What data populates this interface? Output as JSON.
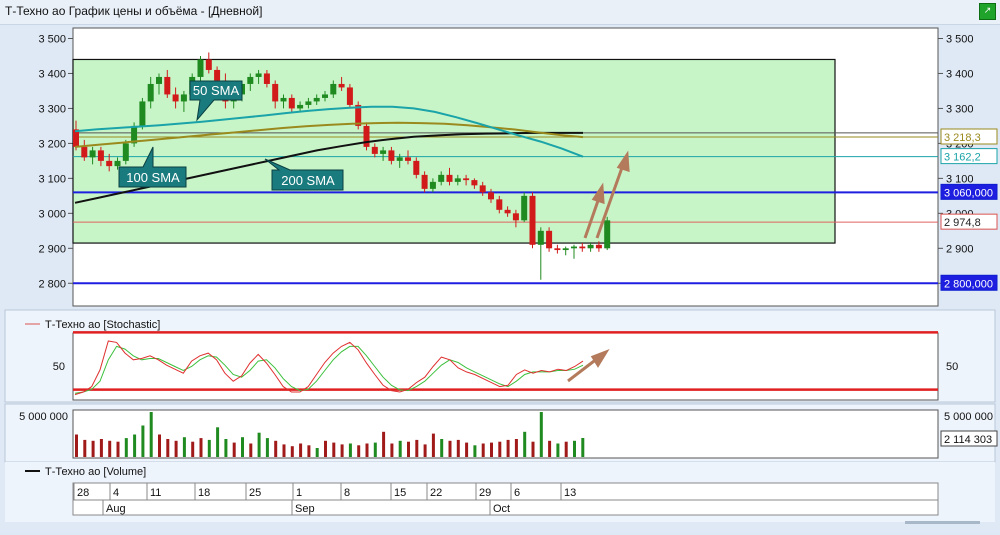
{
  "window": {
    "title": "Т-Техно ао График цены и объёма - [Дневной]"
  },
  "price_panel": {
    "y_ticks": [
      "3 500",
      "3 400",
      "3 300",
      "3 200",
      "3 100",
      "3 000",
      "2 900",
      "2 800"
    ],
    "price_labels": [
      {
        "text": "3 218,3",
        "value": 3218.3,
        "color": "#9a8a1e",
        "fill": "#ffffff",
        "text_color": "#9a8a1e"
      },
      {
        "text": "3 162,2",
        "value": 3162.2,
        "color": "#1aa3a8",
        "fill": "#ffffff",
        "text_color": "#1aa3a8"
      },
      {
        "text": "3 060,000",
        "value": 3060,
        "color": "#0f1fd0",
        "fill": "#1e1ee0",
        "text_color": "#ffffff"
      },
      {
        "text": "2 974,8",
        "value": 2974.8,
        "color": "#d9534f",
        "fill": "#ffffff",
        "text_color": "#222222"
      },
      {
        "text": "2 800,000",
        "value": 2800,
        "color": "#0f1fd0",
        "fill": "#1e1ee0",
        "text_color": "#ffffff"
      }
    ],
    "annotations": {
      "sma50": "50 SMA",
      "sma100": "100 SMA",
      "sma200": "200 SMA"
    }
  },
  "stochastic_panel": {
    "legend": "Т-Техно ао [Stochastic]",
    "tick": "50",
    "levels": [
      80,
      20
    ]
  },
  "volume_panel": {
    "legend": "Т-Техно ао [Volume]",
    "top_label": "5 000 000",
    "last_label": "2 114 303"
  },
  "time_axis": {
    "days": [
      "28",
      "4",
      "11",
      "18",
      "25",
      "1",
      "8",
      "15",
      "22",
      "29",
      "6",
      "13"
    ],
    "months": [
      "Aug",
      "Sep",
      "Oct"
    ]
  },
  "chart_data": {
    "type": "candlestick",
    "y_range": [
      2735,
      3530
    ],
    "candles": [
      [
        3240,
        3265,
        3180,
        3190
      ],
      [
        3190,
        3210,
        3150,
        3160
      ],
      [
        3160,
        3190,
        3140,
        3180
      ],
      [
        3180,
        3190,
        3135,
        3150
      ],
      [
        3150,
        3170,
        3120,
        3135
      ],
      [
        3135,
        3160,
        3125,
        3150
      ],
      [
        3150,
        3210,
        3140,
        3200
      ],
      [
        3200,
        3260,
        3190,
        3250
      ],
      [
        3250,
        3330,
        3240,
        3320
      ],
      [
        3320,
        3390,
        3300,
        3370
      ],
      [
        3370,
        3400,
        3340,
        3390
      ],
      [
        3390,
        3410,
        3330,
        3340
      ],
      [
        3340,
        3360,
        3300,
        3320
      ],
      [
        3320,
        3350,
        3290,
        3340
      ],
      [
        3340,
        3400,
        3330,
        3390
      ],
      [
        3390,
        3450,
        3380,
        3440
      ],
      [
        3440,
        3460,
        3400,
        3410
      ],
      [
        3410,
        3420,
        3370,
        3380
      ],
      [
        3380,
        3400,
        3300,
        3320
      ],
      [
        3320,
        3350,
        3300,
        3340
      ],
      [
        3340,
        3380,
        3320,
        3370
      ],
      [
        3370,
        3400,
        3350,
        3390
      ],
      [
        3390,
        3410,
        3370,
        3400
      ],
      [
        3400,
        3410,
        3360,
        3370
      ],
      [
        3370,
        3380,
        3300,
        3320
      ],
      [
        3320,
        3340,
        3300,
        3330
      ],
      [
        3330,
        3340,
        3290,
        3300
      ],
      [
        3300,
        3320,
        3290,
        3310
      ],
      [
        3310,
        3330,
        3300,
        3320
      ],
      [
        3320,
        3340,
        3310,
        3330
      ],
      [
        3330,
        3350,
        3320,
        3340
      ],
      [
        3340,
        3380,
        3330,
        3370
      ],
      [
        3370,
        3390,
        3350,
        3360
      ],
      [
        3360,
        3370,
        3300,
        3310
      ],
      [
        3310,
        3320,
        3240,
        3250
      ],
      [
        3250,
        3260,
        3180,
        3190
      ],
      [
        3190,
        3200,
        3160,
        3170
      ],
      [
        3170,
        3190,
        3150,
        3180
      ],
      [
        3180,
        3190,
        3140,
        3150
      ],
      [
        3150,
        3170,
        3130,
        3160
      ],
      [
        3160,
        3180,
        3140,
        3150
      ],
      [
        3150,
        3160,
        3100,
        3110
      ],
      [
        3110,
        3120,
        3060,
        3070
      ],
      [
        3070,
        3100,
        3060,
        3090
      ],
      [
        3090,
        3120,
        3080,
        3110
      ],
      [
        3110,
        3130,
        3080,
        3090
      ],
      [
        3090,
        3110,
        3080,
        3100
      ],
      [
        3100,
        3110,
        3080,
        3095
      ],
      [
        3095,
        3100,
        3070,
        3080
      ],
      [
        3080,
        3090,
        3050,
        3060
      ],
      [
        3060,
        3070,
        3030,
        3040
      ],
      [
        3040,
        3050,
        3000,
        3010
      ],
      [
        3010,
        3020,
        2990,
        3000
      ],
      [
        3000,
        3010,
        2960,
        2980
      ],
      [
        2980,
        3060,
        2975,
        3050
      ],
      [
        3050,
        3060,
        2900,
        2910
      ],
      [
        2910,
        2960,
        2810,
        2950
      ],
      [
        2950,
        2960,
        2890,
        2900
      ],
      [
        2900,
        2910,
        2885,
        2895
      ],
      [
        2895,
        2905,
        2880,
        2900
      ],
      [
        2900,
        2910,
        2870,
        2905
      ],
      [
        2905,
        2915,
        2890,
        2900
      ],
      [
        2900,
        2915,
        2890,
        2910
      ],
      [
        2910,
        2920,
        2890,
        2900
      ],
      [
        2900,
        2990,
        2895,
        2980
      ]
    ],
    "sma50": [
      3235,
      3240,
      3244,
      3248,
      3252,
      3257,
      3262,
      3268,
      3274,
      3280,
      3287,
      3293,
      3298,
      3302,
      3305,
      3305,
      3300,
      3290,
      3275,
      3258,
      3240,
      3222,
      3205,
      3185,
      3162
    ],
    "sma100": [
      3190,
      3196,
      3202,
      3208,
      3214,
      3220,
      3226,
      3232,
      3238,
      3244,
      3249,
      3253,
      3256,
      3258,
      3259,
      3258,
      3256,
      3252,
      3246,
      3240,
      3232,
      3224,
      3218
    ],
    "sma200": [
      3030,
      3045,
      3060,
      3075,
      3090,
      3105,
      3120,
      3135,
      3150,
      3165,
      3180,
      3192,
      3203,
      3212,
      3219,
      3223,
      3226,
      3228,
      3229,
      3230,
      3230,
      3230
    ],
    "horizontal_levels": [
      3230,
      3218.3,
      3162.2,
      3060,
      2974.8,
      2800
    ],
    "consolidation_zone": {
      "price_high": 3440,
      "price_low": 2915
    },
    "stochastic": {
      "range": [
        0,
        100
      ],
      "k": [
        8,
        12,
        20,
        45,
        88,
        86,
        70,
        60,
        62,
        66,
        60,
        52,
        46,
        40,
        58,
        66,
        70,
        60,
        40,
        28,
        36,
        55,
        68,
        55,
        38,
        20,
        12,
        12,
        20,
        38,
        56,
        70,
        80,
        86,
        75,
        55,
        38,
        22,
        14,
        12,
        16,
        26,
        34,
        50,
        64,
        60,
        48,
        42,
        38,
        32,
        26,
        20,
        22,
        38,
        45,
        40,
        44,
        42,
        46,
        44,
        50,
        58
      ],
      "d": [
        10,
        12,
        16,
        28,
        60,
        80,
        76,
        66,
        60,
        62,
        62,
        56,
        50,
        44,
        50,
        60,
        66,
        64,
        52,
        38,
        34,
        44,
        58,
        60,
        48,
        32,
        20,
        14,
        16,
        28,
        44,
        60,
        72,
        80,
        80,
        66,
        50,
        34,
        22,
        15,
        14,
        20,
        28,
        40,
        52,
        60,
        56,
        48,
        42,
        36,
        30,
        24,
        20,
        28,
        38,
        42,
        42,
        42,
        44,
        44,
        46,
        52
      ]
    },
    "volume": {
      "y_max": 5000000,
      "bars": [
        [
          2500000,
          "d"
        ],
        [
          1900000,
          "d"
        ],
        [
          1800000,
          "d"
        ],
        [
          2000000,
          "d"
        ],
        [
          1800000,
          "d"
        ],
        [
          1700000,
          "d"
        ],
        [
          2100000,
          "u"
        ],
        [
          2500000,
          "u"
        ],
        [
          3500000,
          "u"
        ],
        [
          5000000,
          "u"
        ],
        [
          2500000,
          "d"
        ],
        [
          2000000,
          "d"
        ],
        [
          1800000,
          "d"
        ],
        [
          2200000,
          "u"
        ],
        [
          1700000,
          "d"
        ],
        [
          2100000,
          "d"
        ],
        [
          1900000,
          "u"
        ],
        [
          3300000,
          "u"
        ],
        [
          2000000,
          "u"
        ],
        [
          1600000,
          "d"
        ],
        [
          2200000,
          "u"
        ],
        [
          1500000,
          "d"
        ],
        [
          2700000,
          "u"
        ],
        [
          2100000,
          "u"
        ],
        [
          1800000,
          "d"
        ],
        [
          1400000,
          "d"
        ],
        [
          1200000,
          "d"
        ],
        [
          1500000,
          "d"
        ],
        [
          1300000,
          "d"
        ],
        [
          1000000,
          "u"
        ],
        [
          1800000,
          "d"
        ],
        [
          1600000,
          "d"
        ],
        [
          1400000,
          "d"
        ],
        [
          1500000,
          "u"
        ],
        [
          1300000,
          "d"
        ],
        [
          1500000,
          "d"
        ],
        [
          1600000,
          "u"
        ],
        [
          2800000,
          "d"
        ],
        [
          1500000,
          "d"
        ],
        [
          1800000,
          "u"
        ],
        [
          1700000,
          "d"
        ],
        [
          1900000,
          "d"
        ],
        [
          1400000,
          "d"
        ],
        [
          2600000,
          "d"
        ],
        [
          2000000,
          "u"
        ],
        [
          1800000,
          "d"
        ],
        [
          1900000,
          "d"
        ],
        [
          1600000,
          "d"
        ],
        [
          1300000,
          "u"
        ],
        [
          1500000,
          "d"
        ],
        [
          1600000,
          "d"
        ],
        [
          1700000,
          "d"
        ],
        [
          1900000,
          "d"
        ],
        [
          2000000,
          "d"
        ],
        [
          2800000,
          "u"
        ],
        [
          1700000,
          "d"
        ],
        [
          5000000,
          "u"
        ],
        [
          1800000,
          "d"
        ],
        [
          1500000,
          "u"
        ],
        [
          1700000,
          "d"
        ],
        [
          1800000,
          "u"
        ],
        [
          2114303,
          "u"
        ]
      ]
    }
  }
}
